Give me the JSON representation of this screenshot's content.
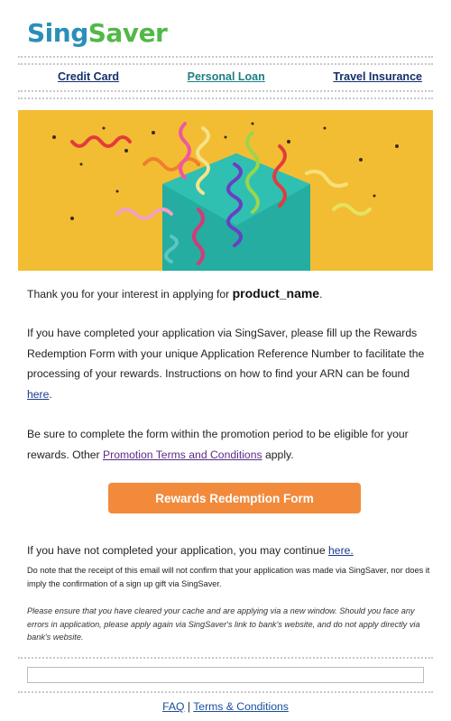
{
  "brand": {
    "part1": "Sing",
    "part2": "Saver"
  },
  "nav": {
    "credit_card": "Credit Card",
    "personal_loan": "Personal Loan",
    "travel_insurance": "Travel Insurance"
  },
  "intro": {
    "text": "Thank you for your interest in applying for",
    "product": "product_name",
    "suffix": "."
  },
  "completed": {
    "text": "If you have completed your application via SingSaver, please fill up the Rewards Redemption Form with your unique Application Reference Number to facilitate the processing of your rewards. Instructions on how to find your ARN can be found",
    "link": "here",
    "suffix": "."
  },
  "promo": {
    "text_before": "Be sure to complete the form within the promotion period to be eligible for your rewards. Other",
    "link": "Promotion Terms and Conditions",
    "text_after": "apply."
  },
  "cta_label": "Rewards Redemption Form",
  "not_completed": {
    "text": "If you have not completed your application, you may continue",
    "link": "here."
  },
  "note": "Do note that the receipt of this email will not confirm that your application was made via SingSaver, nor does it imply the confirmation of a sign up gift via SingSaver.",
  "cache_note": "Please ensure that you have cleared your cache and are applying via a new window. Should you face any errors in application, please apply again via SingSaver's link to bank's website, and do not apply directly via bank's website.",
  "footer": {
    "faq": "FAQ",
    "separator": "|",
    "terms": "Terms & Conditions"
  },
  "colors": {
    "hero_bg": "#f3bd33",
    "envelope": "#24ada0",
    "cta": "#f28a3c",
    "logo_blue": "#2a8fb8",
    "logo_green": "#52b848"
  }
}
